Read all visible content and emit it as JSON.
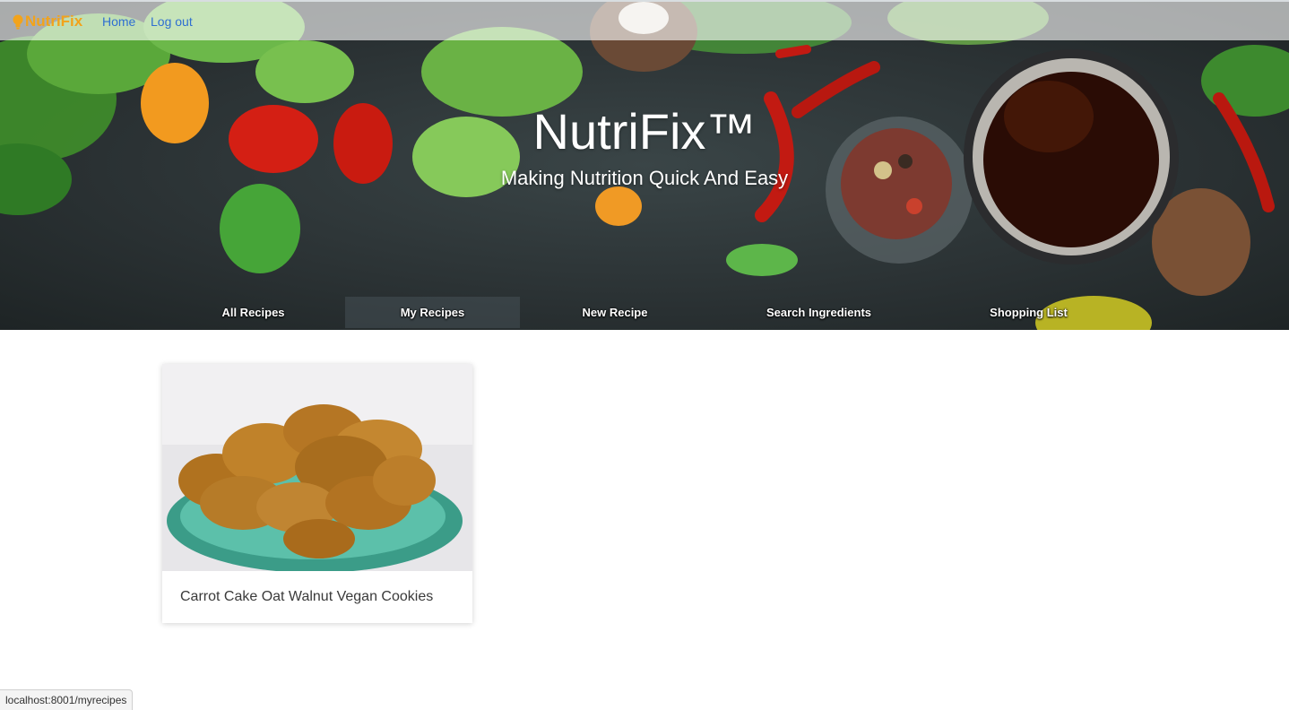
{
  "app": {
    "brand": "NutriFix",
    "brand_icon": "bulb-icon",
    "accent": "#f2a31b",
    "link_color": "#2f6fd1"
  },
  "topnav": {
    "home": "Home",
    "logout": "Log out"
  },
  "hero": {
    "title": "NutriFix™",
    "subtitle": "Making Nutrition Quick And Easy"
  },
  "tabs": [
    {
      "label": "All Recipes",
      "active": false
    },
    {
      "label": "My Recipes",
      "active": true
    },
    {
      "label": "New Recipe",
      "active": false
    },
    {
      "label": "Search Ingredients",
      "active": false
    },
    {
      "label": "Shopping List",
      "active": false
    }
  ],
  "recipes": [
    {
      "title": "Carrot Cake Oat Walnut Vegan Cookies"
    }
  ],
  "status_bar": {
    "url": "localhost:8001/myrecipes"
  }
}
